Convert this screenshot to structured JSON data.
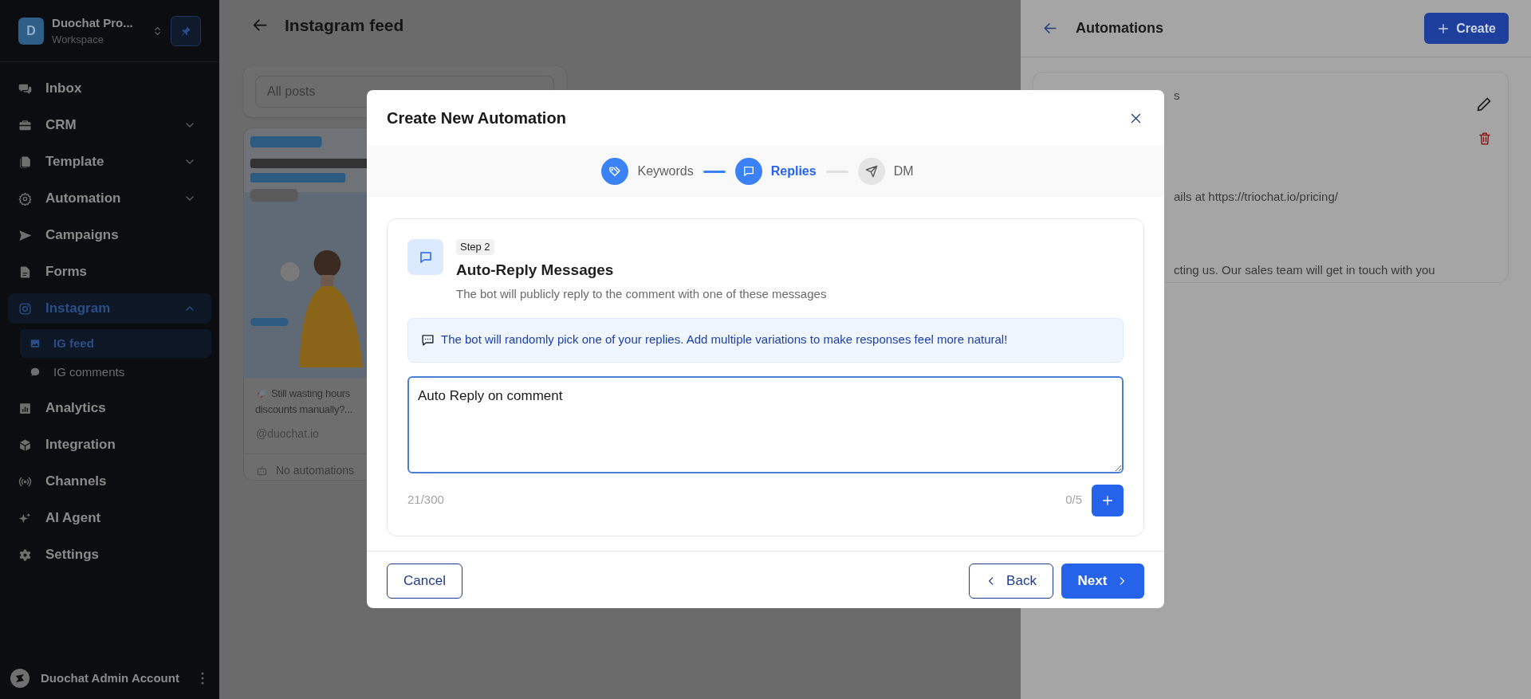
{
  "sidebar": {
    "workspace": {
      "initial": "D",
      "name": "Duochat Pro...",
      "subtitle": "Workspace"
    },
    "items": [
      {
        "label": "Inbox",
        "selected": false
      },
      {
        "label": "CRM",
        "selected": false,
        "expanded": false
      },
      {
        "label": "Template",
        "selected": false,
        "expanded": false
      },
      {
        "label": "Automation",
        "selected": false,
        "expanded": false
      },
      {
        "label": "Campaigns",
        "selected": false
      },
      {
        "label": "Forms",
        "selected": false
      },
      {
        "label": "Instagram",
        "selected": true,
        "expanded": true,
        "children": [
          {
            "label": "IG feed",
            "selected": true
          },
          {
            "label": "IG comments",
            "selected": false
          }
        ]
      },
      {
        "label": "Analytics",
        "selected": false
      },
      {
        "label": "Integration",
        "selected": false
      },
      {
        "label": "Channels",
        "selected": false
      },
      {
        "label": "AI Agent",
        "selected": false
      },
      {
        "label": "Settings",
        "selected": false
      }
    ],
    "account": {
      "name": "Duochat Admin Account"
    }
  },
  "page": {
    "title": "Instagram feed",
    "filter": {
      "value": "All posts"
    },
    "posts": [
      {
        "kind": "picture",
        "caption_lines": [
          "Still wasting hours",
          "discounts manually?..."
        ],
        "handle": "@duochat.io",
        "automations": "No automations"
      }
    ]
  },
  "automations_panel": {
    "title": "Automations",
    "create_button": "Create",
    "card": {
      "lines": [
        "s",
        "ails at https://triochat.io/pricing/",
        "cting us. Our sales team will get in touch with you"
      ]
    }
  },
  "modal": {
    "title": "Create New Automation",
    "steps": [
      {
        "label": "Keywords",
        "completed": true,
        "selected": false
      },
      {
        "label": "Replies",
        "completed": false,
        "selected": true
      },
      {
        "label": "DM",
        "completed": false,
        "selected": false
      }
    ],
    "step_badge": "Step 2",
    "heading": "Auto-Reply Messages",
    "description": "The bot will publicly reply to the comment with one of these messages",
    "tip": "The bot will randomly pick one of your replies. Add multiple variations to make responses feel more natural!",
    "reply_value": "Auto Reply on comment",
    "char_count": "21/300",
    "reply_count": "0/5",
    "buttons": {
      "cancel": "Cancel",
      "back": "Back",
      "next": "Next"
    }
  }
}
